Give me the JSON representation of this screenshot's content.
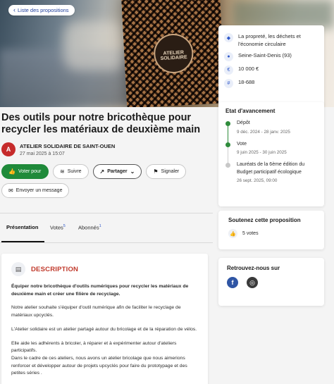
{
  "nav": {
    "back_label": "Liste des propositions"
  },
  "hero": {
    "box_badge": "ATELIER SOLIDAIRE"
  },
  "info": {
    "category": "La propreté, les déchets et l'économie circulaire",
    "location": "Seine-Saint-Denis (93)",
    "budget": "10 000 €",
    "reference": "18-688"
  },
  "proposal": {
    "title": "Des outils pour notre bricothèque pour recycler les matériaux de deuxième main",
    "author_initial": "A",
    "author": "ATELIER SOLIDAIRE DE SAINT-OUEN",
    "date": "27 mai 2025 à 15:07"
  },
  "actions": {
    "vote": "Voter pour",
    "follow": "Suivre",
    "share": "Partager",
    "report": "Signaler",
    "message": "Envoyer un message"
  },
  "tabs": {
    "presentation": "Présentation",
    "votes": "Votes",
    "votes_count": "5",
    "subscribers": "Abonnés",
    "subscribers_count": "1"
  },
  "description": {
    "heading": "DESCRIPTION",
    "lead": "Équiper notre bricothèque d'outils numériques pour recycler les matériaux de deuxième main et créer une filière de recyclage.",
    "p1": "Notre atelier souhaite s'équiper d'outil numérique afin de faciliter le recyclage de matériaux upcyclés.",
    "p2": "L'Atelier solidaire est un atelier partagé autour du bricolage et de la réparation de vélos.",
    "p3": "Elle aide les adhérents à bricoler, à réparer et à expérimenter autour d'ateliers participatifs.",
    "p4": "Dans le cadre de ces ateliers, nous avons un atelier bricolage que nous aimerions renforcer et développer autour de projets upcyclés pour faire du prototypage et des petites séries ."
  },
  "status": {
    "heading": "Etat d'avancement",
    "steps": [
      {
        "name": "Dépôt",
        "dates": "9 déc. 2024 - 28 janv. 2025"
      },
      {
        "name": "Vote",
        "dates": "9 juin 2025 - 30 juin 2025"
      },
      {
        "name": "Lauréats de la 6ème édition du Budget participatif écologique",
        "dates": "26 sept. 2025, 09:00"
      }
    ]
  },
  "support": {
    "heading": "Soutenez cette proposition",
    "votes": "5 votes"
  },
  "social": {
    "heading": "Retrouvez-nous sur"
  },
  "colors": {
    "primary_green": "#1f8a3a",
    "link_blue": "#2e57c9",
    "accent_red": "#c0392b"
  }
}
